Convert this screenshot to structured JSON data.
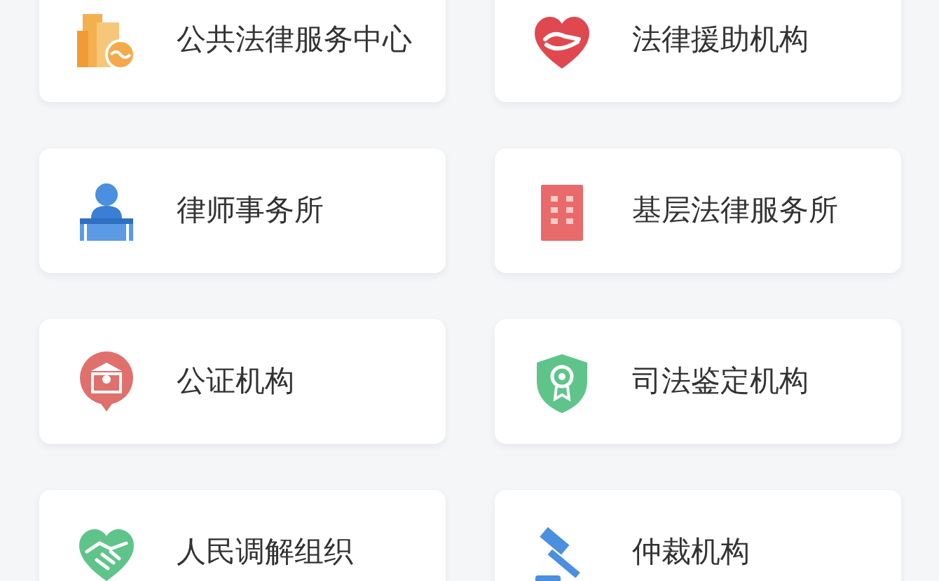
{
  "services": [
    {
      "label": "公共法律服务中心",
      "kind": "buildings"
    },
    {
      "label": "法律援助机构",
      "kind": "heart"
    },
    {
      "label": "律师事务所",
      "kind": "lawyer"
    },
    {
      "label": "基层法律服务所",
      "kind": "office"
    },
    {
      "label": "公证机构",
      "kind": "pin"
    },
    {
      "label": "司法鉴定机构",
      "kind": "shield"
    },
    {
      "label": "人民调解组织",
      "kind": "handshake"
    },
    {
      "label": "仲裁机构",
      "kind": "gavel"
    }
  ]
}
